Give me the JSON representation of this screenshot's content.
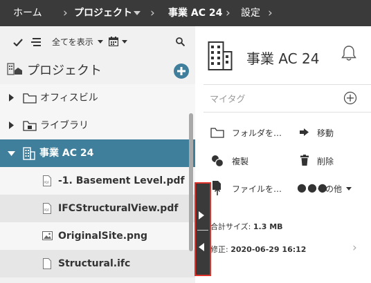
{
  "breadcrumb": {
    "home": "ホーム",
    "projects": "プロジェクト",
    "current": "事業 AC 24",
    "settings": "設定"
  },
  "toolbar": {
    "show_all": "全てを表示"
  },
  "tree": {
    "header": "プロジェクト",
    "items": [
      {
        "label": "オフィスビル"
      },
      {
        "label": "ライブラリ"
      },
      {
        "label": "事業 AC 24"
      }
    ],
    "files": [
      {
        "label": "-1. Basement Level.pdf"
      },
      {
        "label": "IFCStructuralView.pdf"
      },
      {
        "label": "OriginalSite.png"
      },
      {
        "label": "Structural.ifc"
      }
    ]
  },
  "panel": {
    "title": "事業 AC 24",
    "my_tags": "マイタグ",
    "actions": {
      "folder": "フォルダを…",
      "move": "移動",
      "copy": "複製",
      "delete": "削除",
      "file": "ファイルを…",
      "more": "その他"
    },
    "total_size_label": "合計サイズ:",
    "total_size_value": "1.3 MB",
    "modified_label": "修正:",
    "modified_value": "2020-06-29 16:12"
  },
  "colors": {
    "top_bar": "#3a3a3a",
    "selected_row": "#3f7f9b",
    "add_button": "#3f7f9b",
    "highlight_border": "#e0322a"
  }
}
